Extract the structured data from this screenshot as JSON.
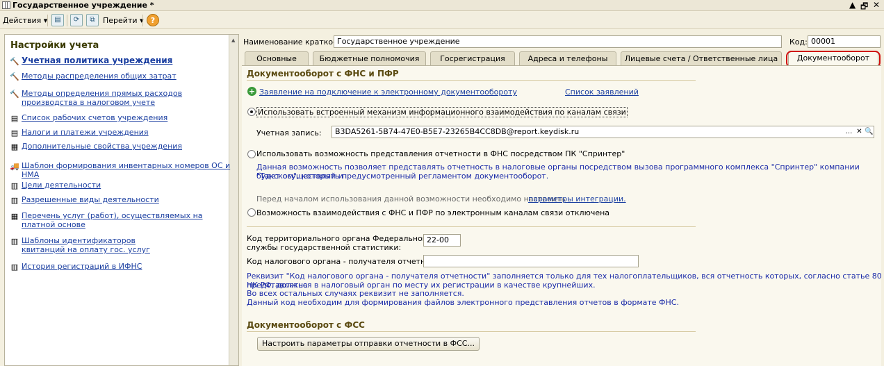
{
  "window": {
    "title": "Государственное учреждение *",
    "controls": [
      "▲",
      "🗗",
      "✕"
    ]
  },
  "toolbar": {
    "actions": "Действия",
    "goto": "Перейти",
    "help": "?"
  },
  "sidebar": {
    "title": "Настройки учета",
    "items": [
      {
        "label": "Учетная политика учреждения",
        "icon": "tools-icon"
      },
      {
        "label": "Методы распределения общих затрат",
        "icon": "tools-icon"
      },
      {
        "label": "Методы определения прямых расходов производства в налоговом учете",
        "icon": "tools-icon"
      },
      {
        "label": "Список рабочих счетов учреждения",
        "icon": "document-icon"
      },
      {
        "label": "Налоги и платежи учреждения",
        "icon": "document-icon"
      },
      {
        "label": "Дополнительные свойства учреждения",
        "icon": "properties-icon"
      },
      {
        "label": "Шаблон формирования инвентарных номеров ОС и НМА",
        "icon": "truck-icon"
      },
      {
        "label": "Цели деятельности",
        "icon": "list-icon"
      },
      {
        "label": "Разрешенные виды деятельности",
        "icon": "list-icon"
      },
      {
        "label": "Перечень услуг (работ), осуществляемых на платной основе",
        "icon": "table-icon"
      },
      {
        "label": "Шаблоны идентификаторов квитанций на оплату гос. услуг",
        "icon": "list-icon"
      },
      {
        "label": "История регистраций в ИФНС",
        "icon": "list-icon"
      }
    ]
  },
  "header": {
    "name_label": "Наименование краткое:",
    "name_value": "Государственное учреждение",
    "code_label": "Код:",
    "code_value": "00001"
  },
  "tabs": [
    {
      "label": "Основные",
      "active": false
    },
    {
      "label": "Бюджетные полномочия",
      "active": false
    },
    {
      "label": "Госрегистрация",
      "active": false
    },
    {
      "label": "Адреса и телефоны",
      "active": false
    },
    {
      "label": "Лицевые счета / Ответственные лица",
      "active": false
    },
    {
      "label": "Документооборот",
      "active": true
    }
  ],
  "edo": {
    "section_title": "Документооборот с ФНС и ПФР",
    "apply_link": "Заявление на подключение к электронному документообороту",
    "list_link": "Список заявлений",
    "option1": "Использовать встроенный механизм информационного взаимодействия по каналам связи",
    "account_label": "Учетная запись:",
    "account_value": "B3DA5261-5B74-47E0-B5E7-23265B4CC8DB@report.keydisk.ru",
    "account_buttons": [
      "...",
      "✕",
      "🔍"
    ],
    "option2": "Использовать возможность представления отчетности в ФНС посредством ПК \"Спринтер\"",
    "option2_desc_1": "Данная возможность позволяет представлять отчетность в налоговые органы посредством вызова программного комплекса \"Спринтер\" компании \"Такском\", который и",
    "option2_desc_2": "будет осуществлять предусмотренный регламентом документооборот.",
    "integration_note": "Перед началом использования данной возможности необходимо настроить",
    "integration_link": "параметры интеграции.",
    "option3": "Возможность взаимодействия с ФНС и ПФР по электронным каналам связи отключена",
    "selected_option": 1
  },
  "codes": {
    "territorial_label_1": "Код территориального органа Федеральной",
    "territorial_label_2": "службы государственной статистики:",
    "territorial_value": "22-00",
    "tax_label": "Код налогового органа - получателя отчетности:",
    "tax_value": "",
    "note_1": "Реквизит \"Код налогового органа - получателя отчетности\" заполняется только для тех налогоплательщиков, вся отчетность которых, согласно статье 80 НК РФ, должна",
    "note_2": "представляться в налоговый орган по месту их регистрации в качестве крупнейших.",
    "note_3": "Во всех остальных случаях реквизит не заполняется.",
    "note_4": "Данный код необходим для формирования файлов электронного представления отчетов в формате ФНС."
  },
  "fss": {
    "section_title": "Документооборот с ФСС",
    "button": "Настроить параметры отправки отчетности в ФСС..."
  }
}
